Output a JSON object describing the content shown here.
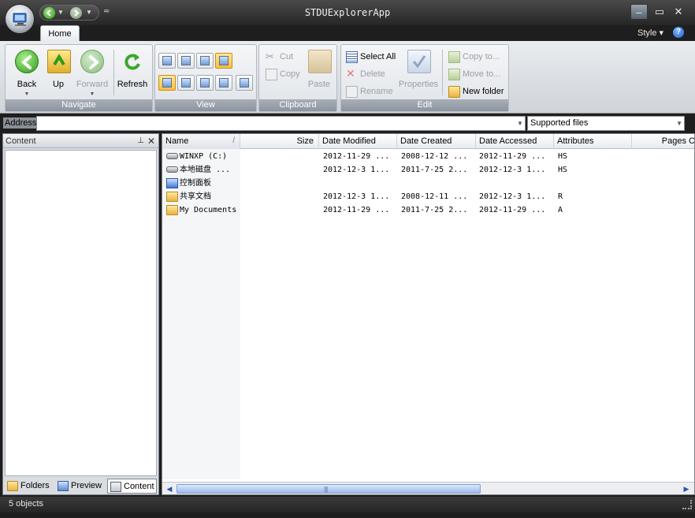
{
  "window": {
    "title": "STDUExplorerApp"
  },
  "ribbon": {
    "tabs": [
      {
        "label": "Home"
      }
    ],
    "style_label": "Style",
    "help": "?",
    "groups": {
      "navigate": {
        "label": "Navigate",
        "back": "Back",
        "up": "Up",
        "forward": "Forward",
        "refresh": "Refresh"
      },
      "view": {
        "label": "View"
      },
      "clipboard": {
        "label": "Clipboard",
        "cut": "Cut",
        "copy": "Copy",
        "paste": "Paste"
      },
      "edit": {
        "label": "Edit",
        "select_all": "Select All",
        "delete": "Delete",
        "rename": "Rename",
        "properties": "Properties",
        "copy_to": "Copy to...",
        "move_to": "Move to...",
        "new_folder": "New folder"
      }
    }
  },
  "address": {
    "label": "Address",
    "value": "",
    "filter": "Supported files"
  },
  "left_pane": {
    "title": "Content",
    "tabs": [
      "Folders",
      "Preview",
      "Content"
    ],
    "selected_tab": "Content"
  },
  "list": {
    "columns": [
      "Name",
      "Size",
      "Date Modified",
      "Date Created",
      "Date Accessed",
      "Attributes",
      "Pages C"
    ],
    "sort_glyph": "/",
    "rows": [
      {
        "icon": "drive-icon",
        "name": "WINXP (C:)",
        "size": "",
        "modified": "2012-11-29 ...",
        "created": "2008-12-12 ...",
        "accessed": "2012-11-29 ...",
        "attributes": "HS"
      },
      {
        "icon": "drive-icon",
        "name": "本地磁盘 ...",
        "size": "",
        "modified": "2012-12-3 1...",
        "created": "2011-7-25 2...",
        "accessed": "2012-12-3 1...",
        "attributes": "HS"
      },
      {
        "icon": "control-panel-icon",
        "name": "控制面板",
        "size": "",
        "modified": "",
        "created": "",
        "accessed": "",
        "attributes": ""
      },
      {
        "icon": "folder-icon",
        "name": "共享文档",
        "size": "",
        "modified": "2012-12-3 1...",
        "created": "2008-12-11 ...",
        "accessed": "2012-12-3 1...",
        "attributes": "R"
      },
      {
        "icon": "folder-icon",
        "name": "My Documents",
        "size": "",
        "modified": "2012-11-29 ...",
        "created": "2011-7-25 2...",
        "accessed": "2012-11-29 ...",
        "attributes": "A"
      }
    ],
    "scroll_grip": "||||"
  },
  "status": {
    "text": "5 objects"
  }
}
